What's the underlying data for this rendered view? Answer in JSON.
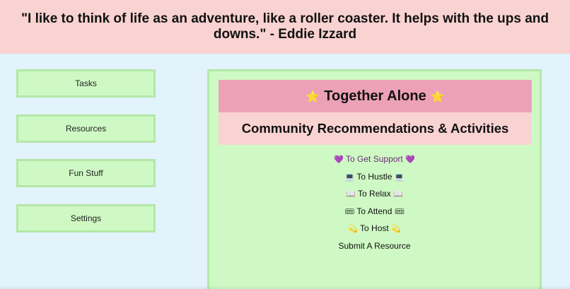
{
  "quote": {
    "text": "\"I like to think of life as an adventure, like a roller coaster. It helps with the ups and downs.\" - Eddie Izzard"
  },
  "sidebar": {
    "items": [
      {
        "label": "Tasks"
      },
      {
        "label": "Resources"
      },
      {
        "label": "Fun Stuff"
      },
      {
        "label": "Settings"
      }
    ]
  },
  "panel": {
    "title": "Together Alone",
    "title_icon": "⭐",
    "subtitle": "Community Recommendations & Activities",
    "links": [
      {
        "label": "To Get Support",
        "icon": "💜"
      },
      {
        "label": "To Hustle",
        "icon": "💻"
      },
      {
        "label": "To Relax",
        "icon": "📖"
      },
      {
        "label": "To Attend",
        "icon": "🎟"
      },
      {
        "label": "To Host",
        "icon": "💫"
      },
      {
        "label": "Submit A Resource"
      }
    ]
  },
  "colors": {
    "background": "#e2f3fc",
    "banner": "#f9d3d1",
    "nav": "#cff9c4",
    "nav_border": "#b3e8a6",
    "title_bar": "#eda1b8",
    "support_link": "#6b2a7a"
  }
}
